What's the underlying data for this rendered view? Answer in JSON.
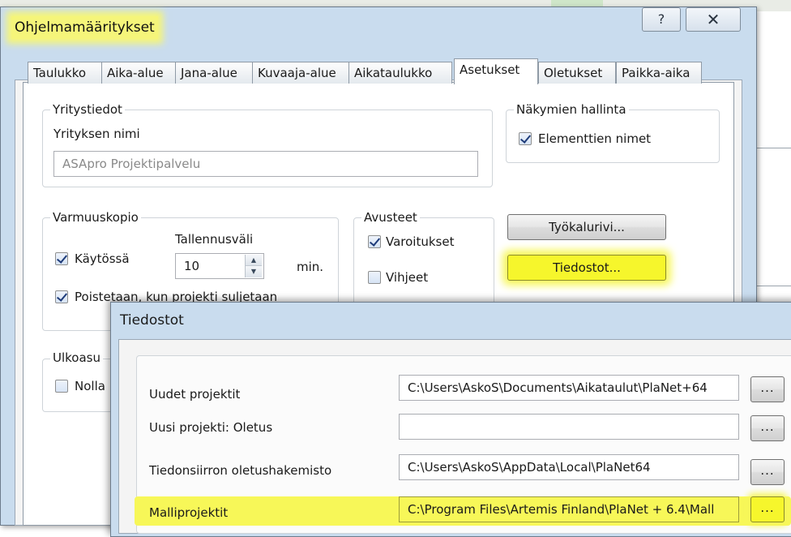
{
  "main_dialog": {
    "title": "Ohjelmamääritykset",
    "help_glyph": "?",
    "close_glyph": "✕",
    "tabs": [
      {
        "label": "Taulukko",
        "active": false
      },
      {
        "label": "Aika-alue",
        "active": false
      },
      {
        "label": "Jana-alue",
        "active": false
      },
      {
        "label": "Kuvaaja-alue",
        "active": false
      },
      {
        "label": "Aikataulukko",
        "active": false
      },
      {
        "label": "Asetukset",
        "active": true
      },
      {
        "label": "Oletukset",
        "active": false
      },
      {
        "label": "Paikka-aika",
        "active": false
      }
    ],
    "company": {
      "legend": "Yritystiedot",
      "name_label": "Yrityksen nimi",
      "name_value": "ASApro Projektipalvelu"
    },
    "views": {
      "legend": "Näkymien hallinta",
      "element_names_label": "Elementtien nimet",
      "element_names_checked": true
    },
    "backup": {
      "legend": "Varmuuskopio",
      "enabled_label": "Käytössä",
      "enabled_checked": true,
      "interval_label": "Tallennusväli",
      "interval_value": "10",
      "interval_unit": "min.",
      "delete_label": "Poistetaan, kun projekti suljetaan",
      "delete_checked": true
    },
    "helpers": {
      "legend": "Avusteet",
      "warnings_label": "Varoitukset",
      "warnings_checked": true,
      "hints_label": "Vihjeet",
      "hints_checked": false
    },
    "toolbar_button": "Työkalurivi...",
    "files_button": "Tiedostot...",
    "appearance": {
      "legend": "Ulkoasu",
      "zero_label": "Nolla",
      "zero_checked": false
    }
  },
  "files_dialog": {
    "title": "Tiedostot",
    "browse_label": "...",
    "rows": [
      {
        "label": "Uudet projektit",
        "value": "C:\\Users\\AskoS\\Documents\\Aikataulut\\PlaNet+64"
      },
      {
        "label": "Uusi projekti: Oletus",
        "value": ""
      },
      {
        "label": "Tiedonsiirron oletushakemisto",
        "value": "C:\\Users\\AskoS\\AppData\\Local\\PlaNet64"
      },
      {
        "label": "Malliprojektit",
        "value": "C:\\Program Files\\Artemis Finland\\PlaNet + 6.4\\Mall"
      }
    ]
  },
  "colors": {
    "highlight": "#f6f62c",
    "frame": "#c9dcee",
    "check": "#1f3c7a"
  }
}
